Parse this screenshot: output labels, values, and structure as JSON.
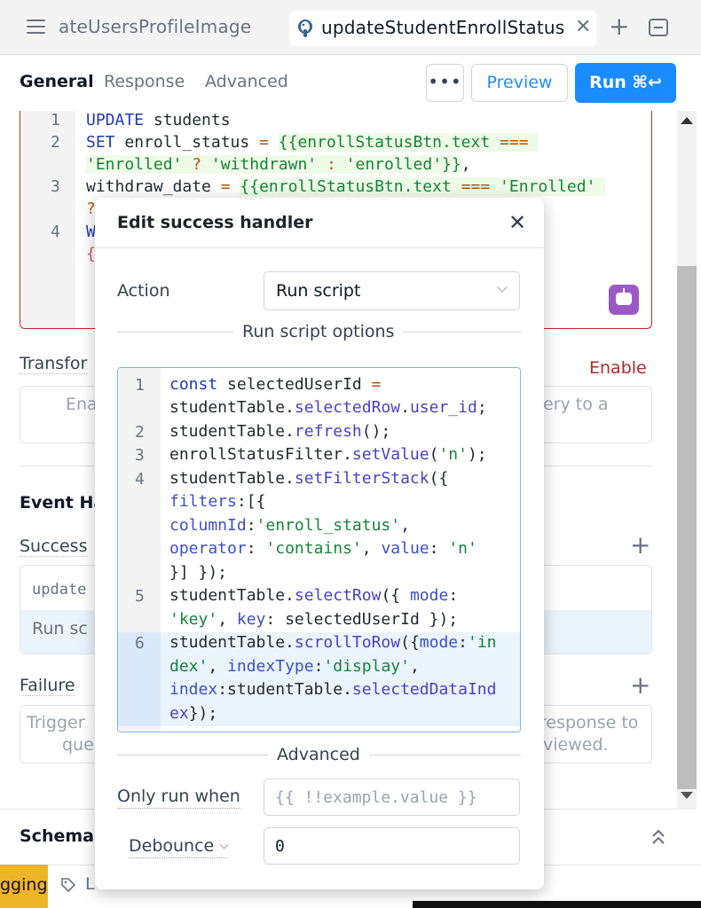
{
  "tabs": {
    "inactive_tab": "ateUsersProfileImage",
    "active_tab": "updateStudentEnrollStatus"
  },
  "toolbar": {
    "tabs": [
      "General",
      "Response",
      "Advanced"
    ],
    "more_label": "•••",
    "preview_label": "Preview",
    "run_label": "Run ⌘↩"
  },
  "editor": {
    "line_numbers": [
      "1",
      "2",
      "3",
      "4"
    ]
  },
  "background": {
    "transformer_label": "Transfor",
    "enable_link": "Enable",
    "transformer_placeholder_left": "Ena",
    "transformer_placeholder_right": "ery to a",
    "event_handlers_label": "Event Ha",
    "success_label": "Success",
    "success_row1": "update",
    "success_row2": "Run sc",
    "failure_label": "Failure",
    "failure_left_1": "Trigger",
    "failure_left_2": "que",
    "failure_right_1": "response to",
    "failure_right_2": "viewed.",
    "schema_label": "Schema",
    "logging_tab": "gging",
    "bottom_partial": "L"
  },
  "modal": {
    "title": "Edit success handler",
    "action_label": "Action",
    "action_value": "Run script",
    "run_script_section": "Run script options",
    "code_line_numbers": [
      "1",
      "2",
      "3",
      "4",
      "5",
      "6"
    ],
    "advanced_section": "Advanced",
    "only_run_when_label": "Only run when",
    "only_run_when_placeholder": "{{ !!example.value }}",
    "debounce_label": "Debounce",
    "debounce_value": "0"
  },
  "colors": {
    "primary": "#1a8cff",
    "error_border": "#c62828",
    "enable_link": "#b02a2a",
    "logging_tab": "#f0b429",
    "ai_button": "#9b59c8"
  },
  "icons": [
    "hamburger-icon",
    "postgres-icon",
    "close-icon",
    "plus-icon",
    "minimize-icon",
    "ai-assistant-icon",
    "chevron-down-icon",
    "chevrons-up-icon",
    "tag-icon"
  ]
}
